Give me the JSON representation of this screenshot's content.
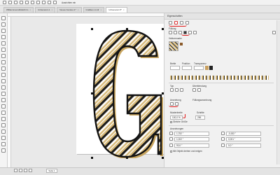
{
  "toolbar": {
    "zoom_label": "Ausrichten ein"
  },
  "tabs": [
    {
      "label": "Willkommensbildschirm"
    },
    {
      "label": "Unbenannt-1"
    },
    {
      "label": "Neues Fenster-1*"
    },
    {
      "label": "Grafiken-4.cdr"
    },
    {
      "label": "Unbenannt-5*"
    }
  ],
  "panel": {
    "title": "Eigenschaften",
    "section_fill": "Füllung",
    "section_pattern": "Vektormuster",
    "row_labels": {
      "a": "Breite",
      "b": "Position",
      "c": "Transparenz"
    },
    "section_type": "Typ",
    "field_type_label": "Überblendung",
    "section_outline": "Anordnung",
    "field_outline_label": "Füllungsanordnung",
    "width_label": "Musterbreite",
    "width_value": "100,0 %",
    "stretch_label": "Schritte",
    "stretch_value": "256",
    "checkbox1_label": "Gleiche Größe",
    "transform_section": "Anordnungen",
    "fields": [
      {
        "label": "x:",
        "value": "1,752 \""
      },
      {
        "label": "y:",
        "value": "1,002 \""
      },
      {
        "label": "w:",
        "value": "-0,002 \""
      },
      {
        "label": "h:",
        "value": "0,001 \""
      },
      {
        "label": "angle:",
        "value": "90,0 °"
      },
      {
        "label": "skew:",
        "value": "0,0 °"
      }
    ],
    "checkbox2_label": "Mit Objekt drehen und neigen"
  },
  "status": {
    "page_tab": "Seite 1"
  }
}
